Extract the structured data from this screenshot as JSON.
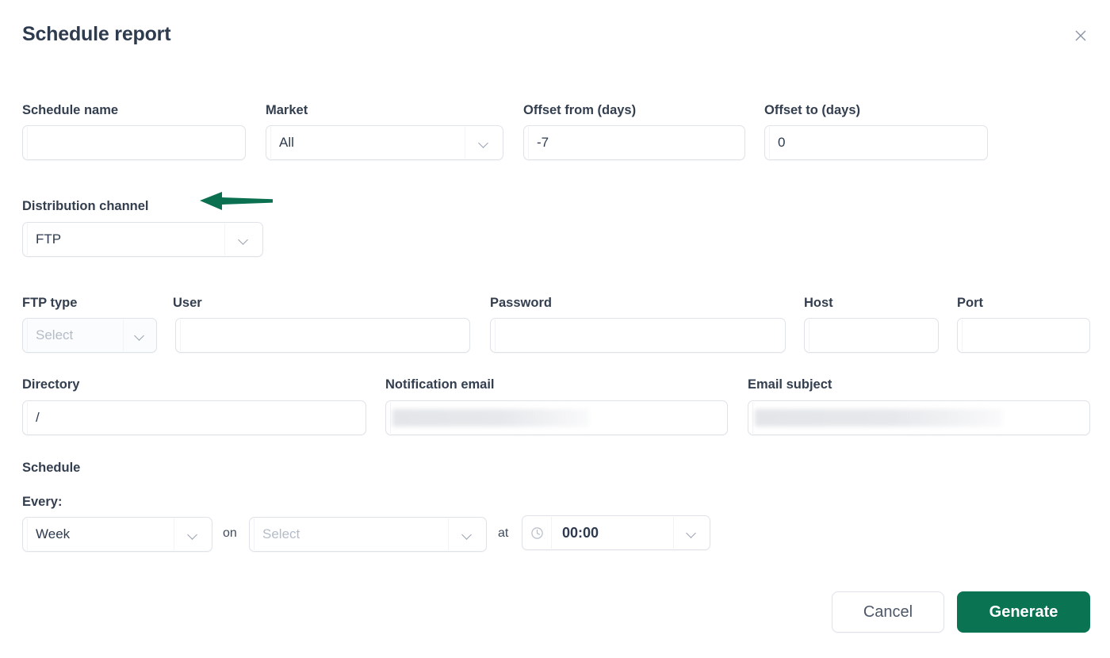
{
  "dialog": {
    "title": "Schedule report",
    "close_icon": "close-icon"
  },
  "colors": {
    "accent_green": "#0a7352",
    "label_text": "#333e4f",
    "border": "#dfe3e9",
    "placeholder": "#b4bcc8"
  },
  "annotation": {
    "type": "arrow",
    "direction": "left",
    "color": "#0b7050",
    "points_at": "Distribution channel"
  },
  "row_top": {
    "schedule_name": {
      "label": "Schedule name",
      "value": "",
      "placeholder": ""
    },
    "market": {
      "label": "Market",
      "value": "All",
      "icon": "chevron-down-icon"
    },
    "offset_from": {
      "label": "Offset from (days)",
      "value": "-7"
    },
    "offset_to": {
      "label": "Offset to (days)",
      "value": "0"
    }
  },
  "distribution": {
    "label": "Distribution channel",
    "value": "FTP",
    "icon": "chevron-down-icon"
  },
  "ftp": {
    "ftp_type": {
      "label": "FTP type",
      "value": "Select",
      "is_placeholder": true,
      "icon": "chevron-down-icon"
    },
    "user": {
      "label": "User",
      "value": ""
    },
    "password": {
      "label": "Password",
      "value": ""
    },
    "host": {
      "label": "Host",
      "value": ""
    },
    "port": {
      "label": "Port",
      "value": ""
    }
  },
  "delivery": {
    "directory": {
      "label": "Directory",
      "value": "/"
    },
    "notification_email": {
      "label": "Notification email",
      "value": "",
      "redacted": true
    },
    "email_subject": {
      "label": "Email subject",
      "value": "",
      "redacted": true
    }
  },
  "schedule": {
    "section_label": "Schedule",
    "every_label": "Every:",
    "interval": {
      "value": "Week",
      "icon": "chevron-down-icon"
    },
    "on_word": "on",
    "day": {
      "value": "Select",
      "is_placeholder": true,
      "icon": "chevron-down-icon"
    },
    "at_word": "at",
    "time": {
      "value": "00:00",
      "icon": "clock-icon",
      "chevron": "chevron-down-icon"
    }
  },
  "footer": {
    "cancel_label": "Cancel",
    "generate_label": "Generate"
  }
}
